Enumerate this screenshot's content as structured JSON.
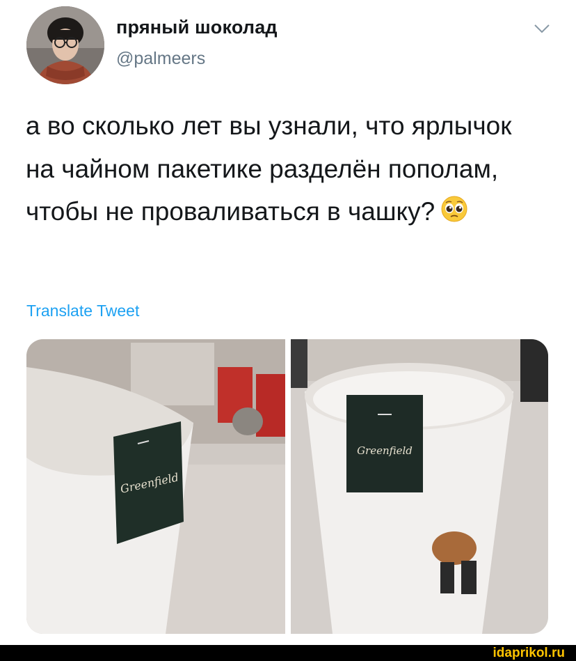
{
  "user": {
    "display_name": "пряный шоколад",
    "handle": "@palmeers"
  },
  "tweet": {
    "text": "а во сколько лет вы узнали, что ярлычок на чайном пакетике разделён пополам, чтобы не проваливаться в чашку?",
    "emoji": "pleading-face"
  },
  "translate_label": "Translate Tweet",
  "photos": [
    {
      "tag_text": "Greenfield"
    },
    {
      "tag_text": "Greenfield"
    }
  ],
  "watermark": "idaprikol.ru",
  "colors": {
    "text": "#14171a",
    "secondary": "#657786",
    "link": "#1da1f2",
    "watermark": "#ffc400"
  }
}
